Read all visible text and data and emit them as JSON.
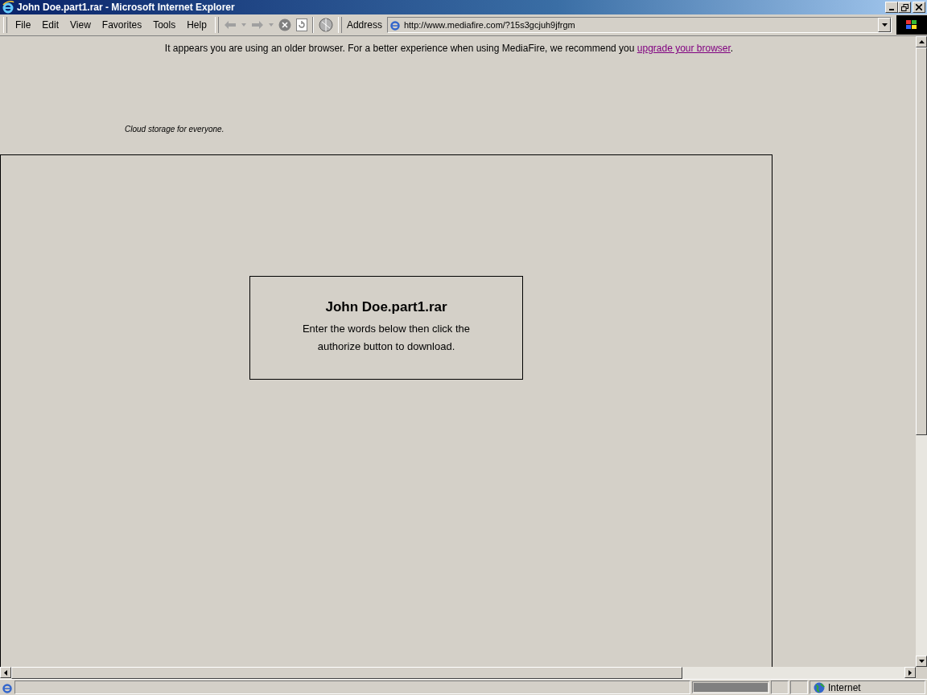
{
  "window": {
    "title": "John Doe.part1.rar - Microsoft Internet Explorer"
  },
  "menu": [
    "File",
    "Edit",
    "View",
    "Favorites",
    "Tools",
    "Help"
  ],
  "address": {
    "label": "Address",
    "value": "http://www.mediafire.com/?15s3gcjuh9jfrgm"
  },
  "notice": {
    "text": "It appears you are using an older browser. For a better experience when using MediaFire, we recommend you ",
    "link": "upgrade your browser",
    "end": "."
  },
  "tagline": "Cloud storage for everyone.",
  "download": {
    "title": "John Doe.part1.rar",
    "message": "Enter the words below then click the authorize button to download."
  },
  "status_bar": {
    "progress": {
      "level": 1
    },
    "zone": "Internet"
  }
}
